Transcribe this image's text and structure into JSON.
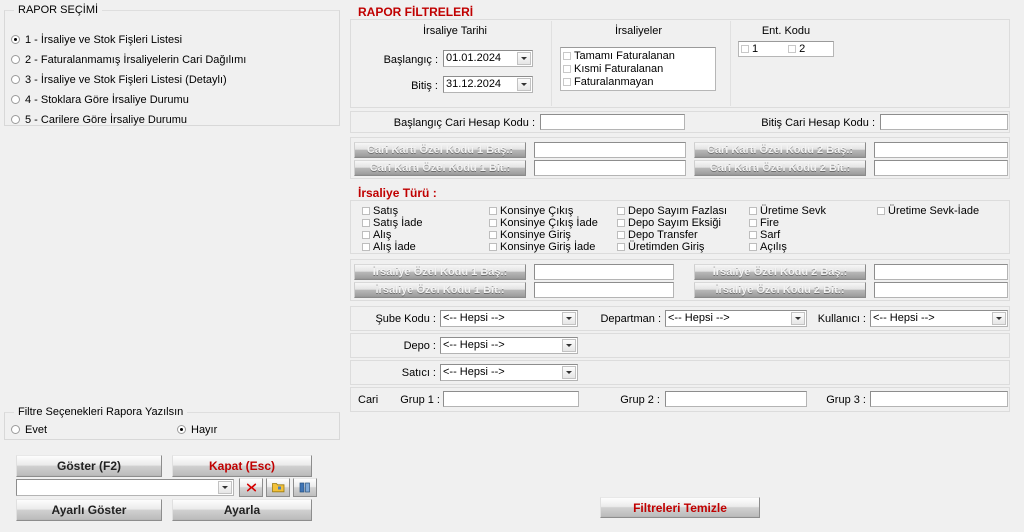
{
  "report_selection": {
    "title": "RAPOR SEÇİMİ",
    "items": [
      {
        "label": "1 - İrsaliye ve Stok Fişleri Listesi",
        "selected": true
      },
      {
        "label": "2 - Faturalanmamış İrsaliyelerin Cari Dağılımı",
        "selected": false
      },
      {
        "label": "3 - İrsaliye ve Stok Fişleri Listesi (Detaylı)",
        "selected": false
      },
      {
        "label": "4 - Stoklara Göre İrsaliye Durumu",
        "selected": false
      },
      {
        "label": "5 - Carilere Göre İrsaliye Durumu",
        "selected": false
      }
    ]
  },
  "filters": {
    "title": "RAPOR FİLTRELERİ",
    "date_group": {
      "title": "İrsaliye Tarihi",
      "start_label": "Başlangıç :",
      "start_value": "01.01.2024",
      "end_label": "Bitiş :",
      "end_value": "31.12.2024"
    },
    "dispatch_group": {
      "title": "İrsaliyeler",
      "items": [
        {
          "label": "Tamamı Faturalanan",
          "checked": false
        },
        {
          "label": "Kısmi Faturalanan",
          "checked": false
        },
        {
          "label": "Faturalanmayan",
          "checked": false
        }
      ]
    },
    "ent_group": {
      "title": "Ent. Kodu",
      "items": [
        {
          "label": "1",
          "checked": false
        },
        {
          "label": "2",
          "checked": false
        }
      ]
    },
    "account_code": {
      "start_label": "Başlangıç Cari Hesap Kodu :",
      "start_value": "",
      "end_label": "Bitiş Cari Hesap Kodu :",
      "end_value": ""
    },
    "cari_special_codes": [
      {
        "button": "Cari Kartı Özel Kodu 1 Baş.:",
        "value": ""
      },
      {
        "button": "Cari Kartı Özel Kodu 1 Bit.:",
        "value": ""
      },
      {
        "button": "Cari Kartı Özel Kodu 2 Baş.:",
        "value": ""
      },
      {
        "button": "Cari Kartı Özel Kodu 2 Bit.:",
        "value": ""
      }
    ],
    "dispatch_type": {
      "title": "İrsaliye Türü :",
      "columns": [
        [
          {
            "label": "Satış",
            "checked": false
          },
          {
            "label": "Satış İade",
            "checked": false
          },
          {
            "label": "Alış",
            "checked": false
          },
          {
            "label": "Alış İade",
            "checked": false
          }
        ],
        [
          {
            "label": "Konsinye Çıkış",
            "checked": false
          },
          {
            "label": "Konsinye Çıkış İade",
            "checked": false
          },
          {
            "label": "Konsinye Giriş",
            "checked": false
          },
          {
            "label": "Konsinye Giriş İade",
            "checked": false
          }
        ],
        [
          {
            "label": "Depo Sayım Fazlası",
            "checked": false
          },
          {
            "label": "Depo Sayım Eksiği",
            "checked": false
          },
          {
            "label": "Depo Transfer",
            "checked": false
          },
          {
            "label": "Üretimden Giriş",
            "checked": false
          }
        ],
        [
          {
            "label": "Üretime Sevk",
            "checked": false
          },
          {
            "label": "Fire",
            "checked": false
          },
          {
            "label": "Sarf",
            "checked": false
          },
          {
            "label": "Açılış",
            "checked": false
          }
        ],
        [
          {
            "label": "Üretime Sevk-İade",
            "checked": false
          }
        ]
      ]
    },
    "irsaliye_special_codes": [
      {
        "button": "İrsaliye Özel Kodu 1 Baş.:",
        "value": ""
      },
      {
        "button": "İrsaliye Özel Kodu 1 Bit.:",
        "value": ""
      },
      {
        "button": "İrsaliye Özel Kodu 2 Baş.:",
        "value": ""
      },
      {
        "button": "İrsaliye Özel Kodu 2 Bit.:",
        "value": ""
      }
    ],
    "selects": {
      "sube_label": "Şube Kodu :",
      "sube_value": "<-- Hepsi -->",
      "departman_label": "Departman :",
      "departman_value": "<-- Hepsi -->",
      "kullanici_label": "Kullanıcı :",
      "kullanici_value": "<-- Hepsi -->",
      "depo_label": "Depo :",
      "depo_value": "<-- Hepsi -->",
      "satici_label": "Satıcı :",
      "satici_value": "<-- Hepsi -->"
    },
    "cari_groups": {
      "prefix": "Cari",
      "g1_label": "Grup 1 :",
      "g1_value": "",
      "g2_label": "Grup 2 :",
      "g2_value": "",
      "g3_label": "Grup 3 :",
      "g3_value": ""
    },
    "clear_button": "Filtreleri Temizle"
  },
  "filter_options": {
    "title": "Filtre Seçenekleri Rapora Yazılsın",
    "yes_label": "Evet",
    "yes_selected": false,
    "no_label": "Hayır",
    "no_selected": true
  },
  "actions": {
    "show_label": "Göster (F2)",
    "close_label": "Kapat (Esc)",
    "preset_value": "",
    "delete_icon": "red-x-icon",
    "folder_icon": "folder-icon",
    "book_icon": "book-icon",
    "show_adjusted_label": "Ayarlı Göster",
    "adjust_label": "Ayarla"
  },
  "colors": {
    "accent_red": "#c00000",
    "window_bg": "#f0f0f0",
    "field_bg": "#ffffff"
  }
}
